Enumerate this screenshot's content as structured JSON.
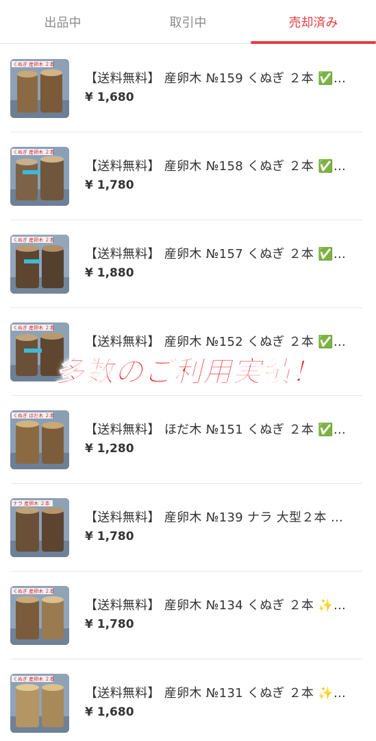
{
  "tabs": [
    {
      "label": "出品中",
      "active": false
    },
    {
      "label": "取引中",
      "active": false
    },
    {
      "label": "売却済み",
      "active": true
    }
  ],
  "accent_color": "#e83b3f",
  "items": [
    {
      "title": "【送料無料】 産卵木 №159 くぬぎ ２本 ✅…",
      "price": "¥ 1,680",
      "thumb_caption": "くぬぎ 産卵木 ２本"
    },
    {
      "title": "【送料無料】 産卵木 №158 くぬぎ ２本 ✅…",
      "price": "¥ 1,780",
      "thumb_caption": "くぬぎ 産卵木 ２本"
    },
    {
      "title": "【送料無料】 産卵木 №157 くぬぎ ２本 ✅…",
      "price": "¥ 1,880",
      "thumb_caption": "くぬぎ 産卵木 ２本"
    },
    {
      "title": "【送料無料】 産卵木 №152 くぬぎ ２本 ✅…",
      "price": "",
      "thumb_caption": "くぬぎ 産卵木 ２本"
    },
    {
      "title": "【送料無料】 ほだ木 №151 くぬぎ ２本 ✅…",
      "price": "¥ 1,280",
      "thumb_caption": "くぬぎ ほだ木 ２本"
    },
    {
      "title": "【送料無料】 産卵木 №139 ナラ 大型２本 …",
      "price": "¥ 1,780",
      "thumb_caption": "ナラ 産卵木 ２本"
    },
    {
      "title": "【送料無料】 産卵木 №134 くぬぎ ２本 ✨…",
      "price": "¥ 1,780",
      "thumb_caption": "くぬぎ 産卵木 ２本"
    },
    {
      "title": "【送料無料】 産卵木 №131 くぬぎ ２本 ✨…",
      "price": "¥ 1,680",
      "thumb_caption": "くぬぎ 産卵木 ２本"
    }
  ],
  "overlay_text": "多数のご利用実績！"
}
